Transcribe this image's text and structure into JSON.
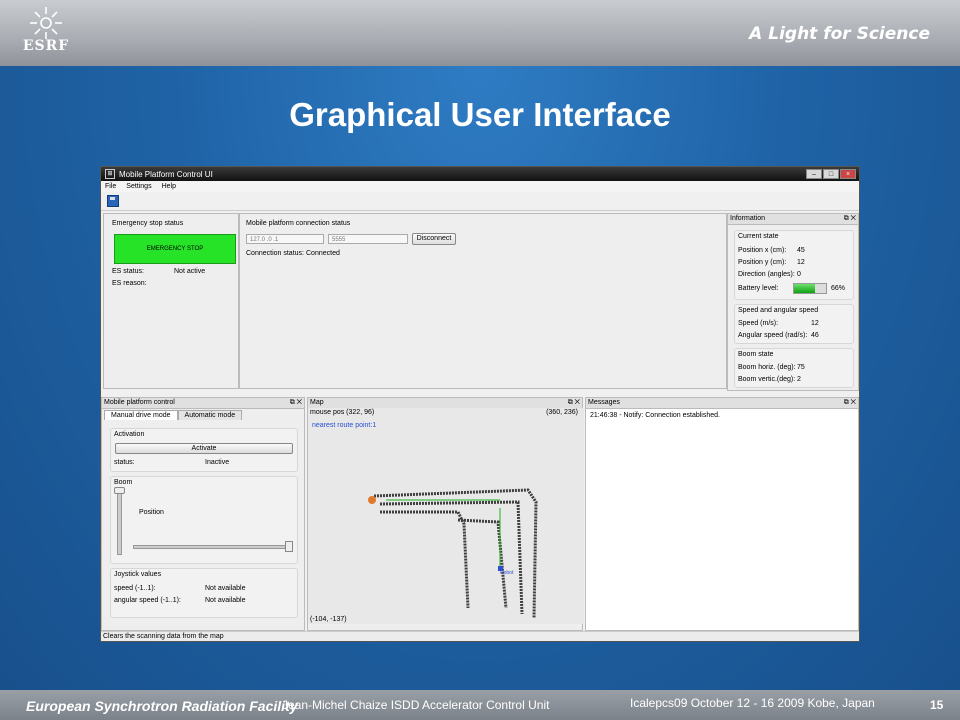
{
  "slide": {
    "logo_text": "ESRF",
    "tagline": "A Light for Science",
    "title": "Graphical User Interface",
    "footer_org": "European Synchrotron Radiation Facility",
    "footer_author": "Jean-Michel Chaize ISDD Accelerator Control Unit",
    "footer_conf": "Icalepcs09 October 12 - 16 2009 Kobe, Japan",
    "page_number": "15"
  },
  "window": {
    "title": "Mobile Platform Control UI",
    "buttons": [
      "–",
      "□",
      "×"
    ],
    "menu": [
      "File",
      "Settings",
      "Help"
    ]
  },
  "emergency": {
    "group_label": "Emergency stop status",
    "button_label": "EMERGENCY STOP",
    "es_status_label": "ES status:",
    "es_status_value": "Not active",
    "es_reason_label": "ES reason:",
    "es_reason_value": ""
  },
  "connection": {
    "group_label": "Mobile platform connection status",
    "ip_value": "127.0 .0 .1",
    "port_value": "5555",
    "disconnect_label": "Disconnect",
    "status_label": "Connection status:",
    "status_value": "Connected"
  },
  "information": {
    "title": "Information",
    "current_state": {
      "label": "Current state",
      "pos_x_label": "Position x (cm):",
      "pos_x_value": "45",
      "pos_y_label": "Position y (cm):",
      "pos_y_value": "12",
      "direction_label": "Direction (angles):",
      "direction_value": "0",
      "battery_label": "Battery level:",
      "battery_value": "66%",
      "battery_fraction": 0.66
    },
    "speed": {
      "label": "Speed and angular speed",
      "speed_label": "Speed (m/s):",
      "speed_value": "12",
      "angular_label": "Angular speed (rad/s):",
      "angular_value": "46"
    },
    "boom": {
      "label": "Boom state",
      "horiz_label": "Boom horiz. (deg):",
      "horiz_value": "75",
      "vertic_label": "Boom vertic.(deg):",
      "vertic_value": "2"
    }
  },
  "control": {
    "title": "Mobile platform control",
    "tabs": [
      "Manual drive mode",
      "Automatic mode"
    ],
    "activation_label": "Activation",
    "activate_button": "Activate",
    "status_label": "status:",
    "status_value": "Inactive",
    "boom_label": "Boom",
    "position_label": "Position",
    "joystick_label": "Joystick values",
    "speed_label": "speed (-1..1):",
    "speed_value": "Not available",
    "angular_label": "angular speed (-1..1):",
    "angular_value": "Not available"
  },
  "map": {
    "title": "Map",
    "mouse_pos": "mouse pos (322, 96)",
    "top_right_coord": "(360, 236)",
    "nearest_route": "nearest route point:1",
    "bottom_left_coord": "(-104, -137)",
    "robot_label": "Robot"
  },
  "messages": {
    "title": "Messages",
    "lines": [
      "21:46:38 - Notify: Connection established."
    ]
  },
  "statusbar": {
    "text": "Clears the scanning data from the map"
  }
}
